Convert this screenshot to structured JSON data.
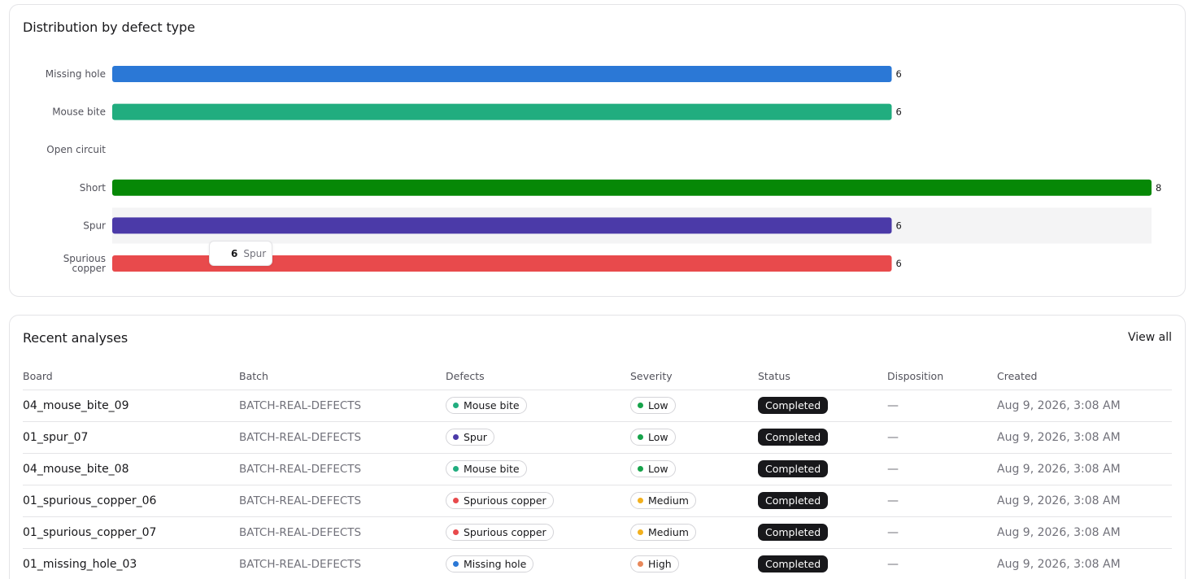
{
  "chart_card": {
    "title": "Distribution by defect type"
  },
  "chart_data": {
    "type": "bar",
    "orientation": "horizontal",
    "title": "Distribution by defect type",
    "categories": [
      "Missing hole",
      "Mouse bite",
      "Open circuit",
      "Short",
      "Spur",
      "Spurious copper"
    ],
    "category_lines": [
      [
        "Missing hole"
      ],
      [
        "Mouse bite"
      ],
      [
        "Open circuit"
      ],
      [
        "Short"
      ],
      [
        "Spur"
      ],
      [
        "Spurious",
        "copper"
      ]
    ],
    "values": [
      6,
      6,
      0,
      8,
      6,
      6
    ],
    "value_labels": [
      "6",
      "6",
      "",
      "8",
      "6",
      "6"
    ],
    "colors": [
      "#2b78d6",
      "#21ad7f",
      "#f0932b",
      "#068806",
      "#4b3aa8",
      "#e84a4c"
    ],
    "xlim": [
      0,
      8
    ],
    "grid": false,
    "legend": "none",
    "highlight_index": 4,
    "tooltip": {
      "value": "6",
      "name": "Spur"
    }
  },
  "recent": {
    "title": "Recent analyses",
    "view_all": "View all",
    "columns": [
      "Board",
      "Batch",
      "Defects",
      "Severity",
      "Status",
      "Disposition",
      "Created"
    ],
    "rows": [
      {
        "board": "04_mouse_bite_09",
        "batch": "BATCH-REAL-DEFECTS",
        "defect": "Mouse bite",
        "defect_color": "#21ad7f",
        "severity": "Low",
        "severity_color": "#16a34a",
        "status": "Completed",
        "disposition": "—",
        "created": "Aug 9, 2026, 3:08 AM"
      },
      {
        "board": "01_spur_07",
        "batch": "BATCH-REAL-DEFECTS",
        "defect": "Spur",
        "defect_color": "#4b3aa8",
        "severity": "Low",
        "severity_color": "#16a34a",
        "status": "Completed",
        "disposition": "—",
        "created": "Aug 9, 2026, 3:08 AM"
      },
      {
        "board": "04_mouse_bite_08",
        "batch": "BATCH-REAL-DEFECTS",
        "defect": "Mouse bite",
        "defect_color": "#21ad7f",
        "severity": "Low",
        "severity_color": "#16a34a",
        "status": "Completed",
        "disposition": "—",
        "created": "Aug 9, 2026, 3:08 AM"
      },
      {
        "board": "01_spurious_copper_06",
        "batch": "BATCH-REAL-DEFECTS",
        "defect": "Spurious copper",
        "defect_color": "#e84a4c",
        "severity": "Medium",
        "severity_color": "#f2b01e",
        "status": "Completed",
        "disposition": "—",
        "created": "Aug 9, 2026, 3:08 AM"
      },
      {
        "board": "01_spurious_copper_07",
        "batch": "BATCH-REAL-DEFECTS",
        "defect": "Spurious copper",
        "defect_color": "#e84a4c",
        "severity": "Medium",
        "severity_color": "#f2b01e",
        "status": "Completed",
        "disposition": "—",
        "created": "Aug 9, 2026, 3:08 AM"
      },
      {
        "board": "01_missing_hole_03",
        "batch": "BATCH-REAL-DEFECTS",
        "defect": "Missing hole",
        "defect_color": "#2b78d6",
        "severity": "High",
        "severity_color": "#e8885a",
        "status": "Completed",
        "disposition": "—",
        "created": "Aug 9, 2026, 3:08 AM"
      }
    ]
  }
}
